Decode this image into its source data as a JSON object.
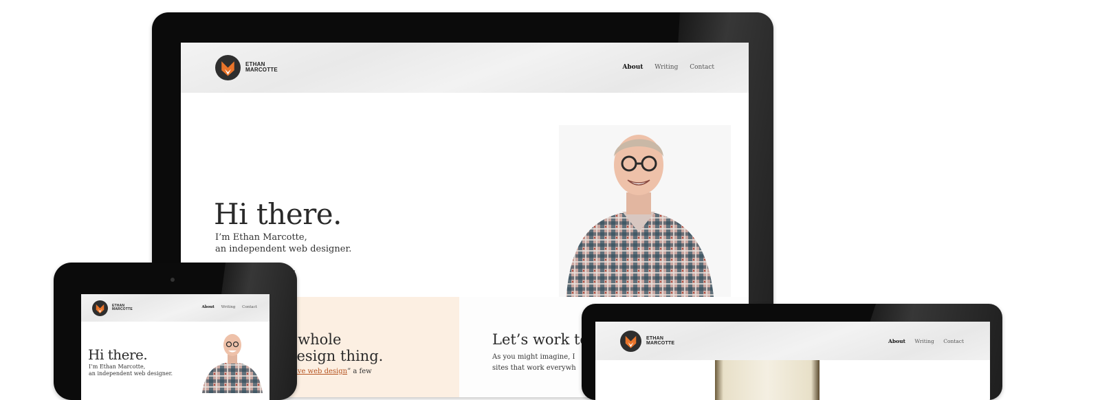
{
  "brand": {
    "line1": "ETHAN",
    "line2": "MARCOTTE"
  },
  "nav": {
    "about": "About",
    "writing": "Writing",
    "contact": "Contact"
  },
  "hero": {
    "title": "Hi there.",
    "intro_line1": "I’m Ethan Marcotte,",
    "intro_line2": "an independent web designer.",
    "trailing": "."
  },
  "panels": {
    "left_title_line1": "t whole",
    "left_title_line2": "design thing.",
    "left_link": "nsive web design",
    "left_after_link": "” a few",
    "right_title": "Let’s work to",
    "right_line1": "As you might imagine, I",
    "right_line2": "sites that work everywh"
  },
  "colors": {
    "bezel": "#0b0b0b",
    "header_bg": "#efefef",
    "fox_orange": "#e9742a",
    "panel_peach": "#fcefe2",
    "link": "#b5531f"
  }
}
